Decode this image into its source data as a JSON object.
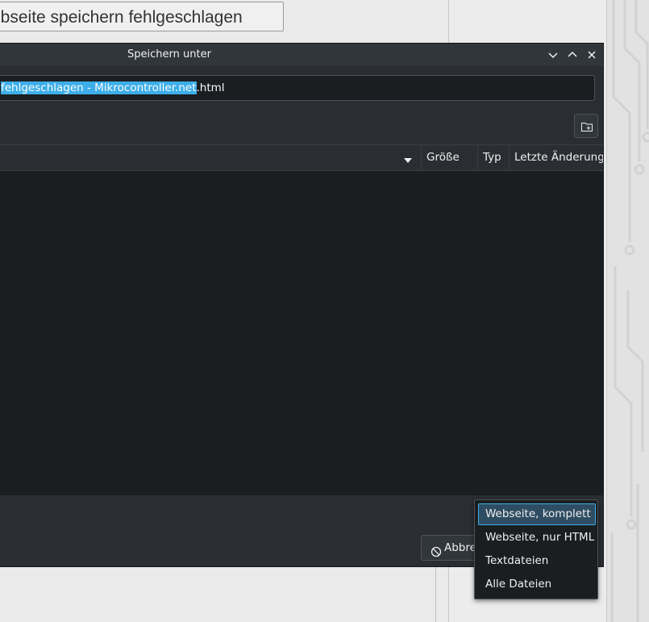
{
  "background": {
    "page_title": "ebseite speichern fehlgeschlagen"
  },
  "dialog": {
    "title": "Speichern unter",
    "filename": {
      "selected_text": " fehlgeschlagen - Mikrocontroller.net",
      "extension": ".html"
    },
    "columns": [
      "Größe",
      "Typ",
      "Letzte Änderung"
    ],
    "cancel_label": "Abbre",
    "accent_color": "#3daee9"
  },
  "filetype_menu": {
    "items": [
      "Webseite, komplett",
      "Webseite, nur HTML",
      "Textdateien",
      "Alle Dateien"
    ],
    "selected": "Webseite, komplett"
  }
}
